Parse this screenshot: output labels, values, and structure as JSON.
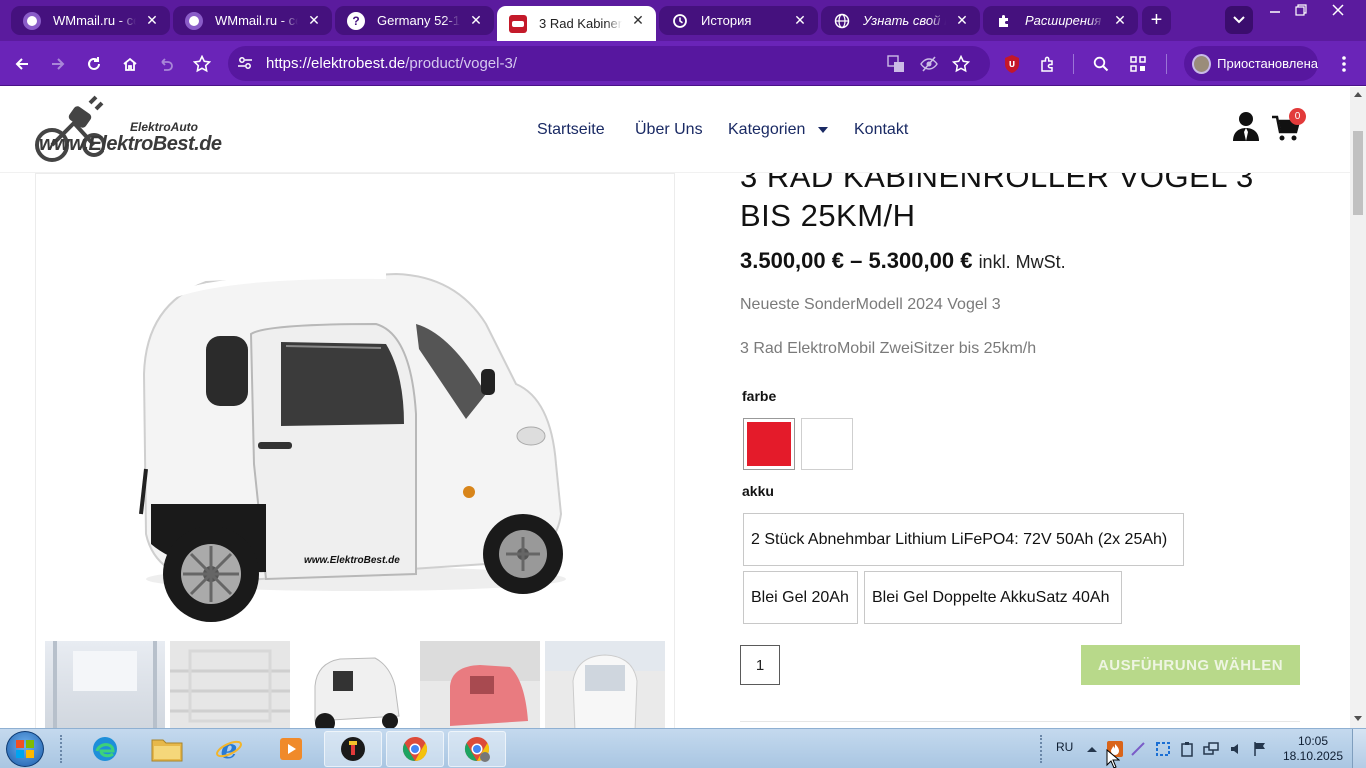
{
  "browser": {
    "tabs": [
      {
        "title": "WMmail.ru - серфинг",
        "active": false
      },
      {
        "title": "WMmail.ru - серфинг",
        "active": false
      },
      {
        "title": "Germany 52-121",
        "active": false
      },
      {
        "title": "3 Rad KabinenRoller",
        "active": true
      },
      {
        "title": "История",
        "active": false
      },
      {
        "title": "Узнать свой IP адрес",
        "active": false
      },
      {
        "title": "Расширения",
        "active": false
      }
    ],
    "url_host": "https://elektrobest.de",
    "url_path": "/product/vogel-3/",
    "profile_label": "Приостановлена",
    "accent_color": "#6a24b8"
  },
  "site": {
    "logo_top": "ElektroAuto",
    "logo_main": "www.ElektroBest.de",
    "nav": [
      "Startseite",
      "Über Uns",
      "Kategorien",
      "Kontakt"
    ],
    "cart_count": "0"
  },
  "product": {
    "title": "3 RAD KABINENROLLER VOGEL 3 BIS 25KM/H",
    "price_range": "3.500,00 € – 5.300,00 €",
    "tax_note": "inkl. MwSt.",
    "desc1": "Neueste SonderModell 2024 Vogel 3",
    "desc2": "3 Rad ElektroMobil ZweiSitzer bis 25km/h",
    "color_label": "farbe",
    "colors": [
      "#e41b2a",
      "#ffffff"
    ],
    "battery_label": "akku",
    "battery_options": [
      "2 Stück Abnehmbar Lithium LiFePO4: 72V 50Ah (2x 25Ah)",
      "Blei Gel 20Ah",
      "Blei Gel Doppelte AkkuSatz 40Ah"
    ],
    "quantity": "1",
    "cta_label": "AUSFÜHRUNG WÄHLEN",
    "watermark": "www.ElektroBest.de"
  },
  "taskbar": {
    "lang": "RU",
    "time": "10:05",
    "date": "18.10.2025"
  }
}
